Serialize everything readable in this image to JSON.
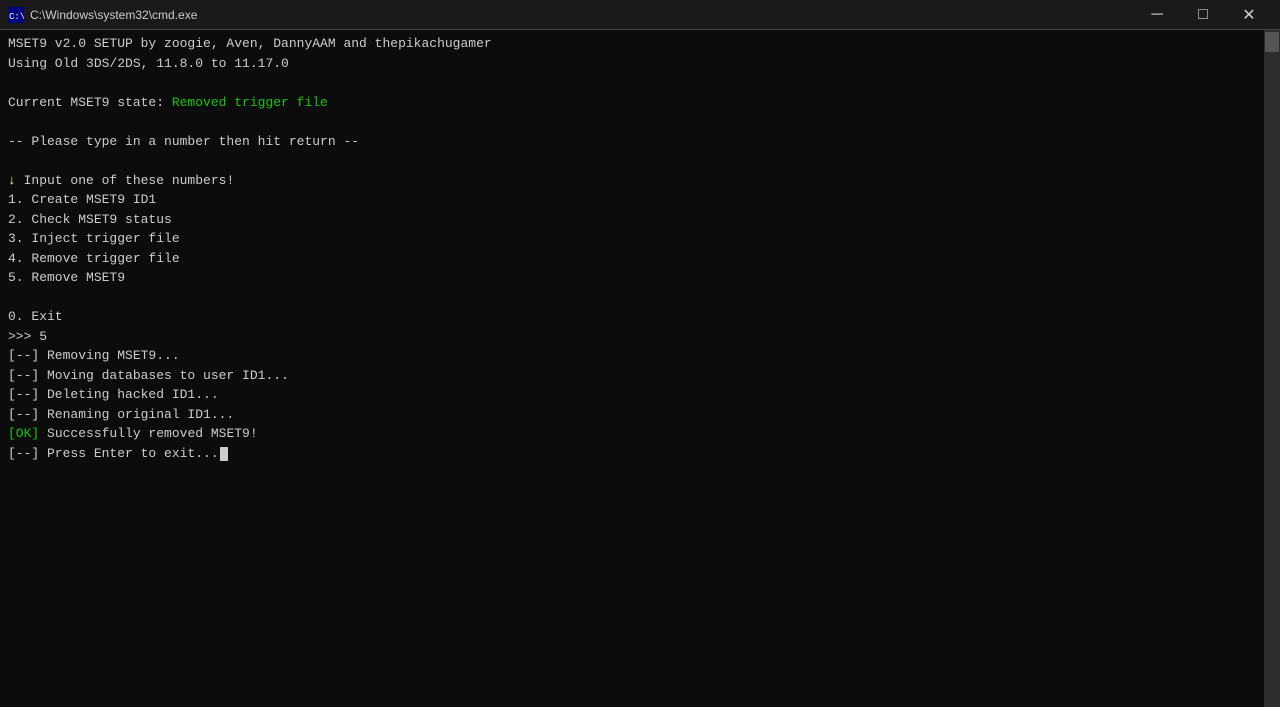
{
  "titlebar": {
    "title": "C:\\Windows\\system32\\cmd.exe",
    "icon": "cmd",
    "min_label": "─",
    "max_label": "□",
    "close_label": "✕"
  },
  "console": {
    "lines": [
      {
        "id": "line1",
        "text": "MSET9 v2.0 SETUP by zoogie, Aven, DannyAAM and thepikachugamer",
        "color": "white"
      },
      {
        "id": "line2",
        "text": "Using Old 3DS/2DS, 11.8.0 to 11.17.0",
        "color": "white"
      },
      {
        "id": "line3",
        "text": "",
        "color": "white"
      },
      {
        "id": "line4_pre",
        "text": "Current MSET9 state: ",
        "color": "white"
      },
      {
        "id": "line4_status",
        "text": "Removed trigger file",
        "color": "green"
      },
      {
        "id": "line5",
        "text": "",
        "color": "white"
      },
      {
        "id": "line6",
        "text": "-- Please type in a number then hit return --",
        "color": "white"
      },
      {
        "id": "line7",
        "text": "",
        "color": "white"
      },
      {
        "id": "line8_arrow",
        "text": "↓ ",
        "color": "yellow"
      },
      {
        "id": "line8_text",
        "text": "Input one of these numbers!",
        "color": "white"
      },
      {
        "id": "line9",
        "text": "1. Create MSET9 ID1",
        "color": "white"
      },
      {
        "id": "line10",
        "text": "2. Check MSET9 status",
        "color": "white"
      },
      {
        "id": "line11",
        "text": "3. Inject trigger file",
        "color": "white"
      },
      {
        "id": "line12",
        "text": "4. Remove trigger file",
        "color": "white"
      },
      {
        "id": "line13",
        "text": "5. Remove MSET9",
        "color": "white"
      },
      {
        "id": "line14",
        "text": "",
        "color": "white"
      },
      {
        "id": "line15",
        "text": "0. Exit",
        "color": "white"
      },
      {
        "id": "line16",
        "text": ">>> 5",
        "color": "white"
      },
      {
        "id": "line17",
        "text": "[--] Removing MSET9...",
        "color": "white"
      },
      {
        "id": "line18",
        "text": "[--] Moving databases to user ID1...",
        "color": "white"
      },
      {
        "id": "line19",
        "text": "[--] Deleting hacked ID1...",
        "color": "white"
      },
      {
        "id": "line20",
        "text": "[--] Renaming original ID1...",
        "color": "white"
      },
      {
        "id": "line21_ok",
        "text": "[OK]",
        "color": "green"
      },
      {
        "id": "line21_text",
        "text": " Successfully removed MSET9!",
        "color": "white"
      },
      {
        "id": "line22",
        "text": "[--] Press Enter to exit...",
        "color": "white"
      }
    ]
  }
}
